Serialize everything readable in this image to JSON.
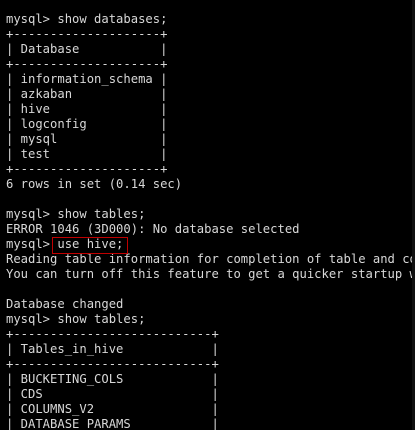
{
  "terminal": {
    "lines": [
      "mysql> show databases;",
      "+--------------------+",
      "| Database           |",
      "+--------------------+",
      "| information_schema |",
      "| azkaban            |",
      "| hive               |",
      "| logconfig          |",
      "| mysql              |",
      "| test               |",
      "+--------------------+",
      "6 rows in set (0.14 sec)",
      "",
      "mysql> show tables;",
      "ERROR 1046 (3D000): No database selected",
      "mysql> use hive;",
      "Reading table information for completion of table and colu",
      "You can turn off this feature to get a quicker startup wit",
      "",
      "Database changed",
      "mysql> show tables;",
      "+---------------------------+",
      "| Tables_in_hive            |",
      "+---------------------------+",
      "| BUCKETING_COLS            |",
      "| CDS                       |",
      "| COLUMNS_V2                |",
      "| DATABASE_PARAMS           |"
    ]
  },
  "colors": {
    "background": "#000000",
    "text": "#d8d8d8",
    "highlight_border": "#c00000"
  }
}
